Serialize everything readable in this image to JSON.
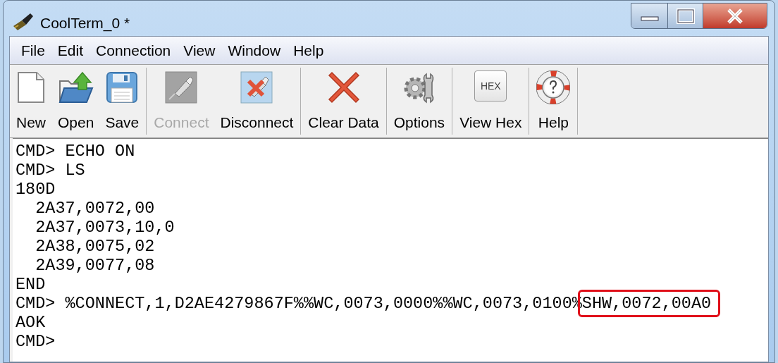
{
  "window": {
    "title": "CoolTerm_0 *"
  },
  "menu": [
    "File",
    "Edit",
    "Connection",
    "View",
    "Window",
    "Help"
  ],
  "toolbar": [
    [
      {
        "kind": "new",
        "label": "New",
        "disabled": false
      },
      {
        "kind": "open",
        "label": "Open",
        "disabled": false
      },
      {
        "kind": "save",
        "label": "Save",
        "disabled": false
      }
    ],
    [
      {
        "kind": "connect",
        "label": "Connect",
        "disabled": true
      },
      {
        "kind": "disconnect",
        "label": "Disconnect",
        "disabled": false
      }
    ],
    [
      {
        "kind": "clear",
        "label": "Clear Data",
        "disabled": false
      }
    ],
    [
      {
        "kind": "options",
        "label": "Options",
        "disabled": false
      }
    ],
    [
      {
        "kind": "hex",
        "label": "View Hex",
        "icon_label": "HEX",
        "disabled": false
      }
    ],
    [
      {
        "kind": "help",
        "label": "Help",
        "disabled": false
      }
    ]
  ],
  "terminal": [
    {
      "text": "CMD> ECHO ON"
    },
    {
      "text": "CMD> LS"
    },
    {
      "text": "180D"
    },
    {
      "text": "  2A37,0072,00"
    },
    {
      "text": "  2A37,0073,10,0"
    },
    {
      "text": "  2A38,0075,02"
    },
    {
      "text": "  2A39,0077,08"
    },
    {
      "text": "END"
    },
    {
      "text": "CMD> %CONNECT,1,D2AE4279867F%%WC,0073,0000%%WC,0073,0100%",
      "highlight": "SHW,0072,00A0"
    },
    {
      "text": "AOK"
    },
    {
      "text": "CMD>"
    }
  ]
}
